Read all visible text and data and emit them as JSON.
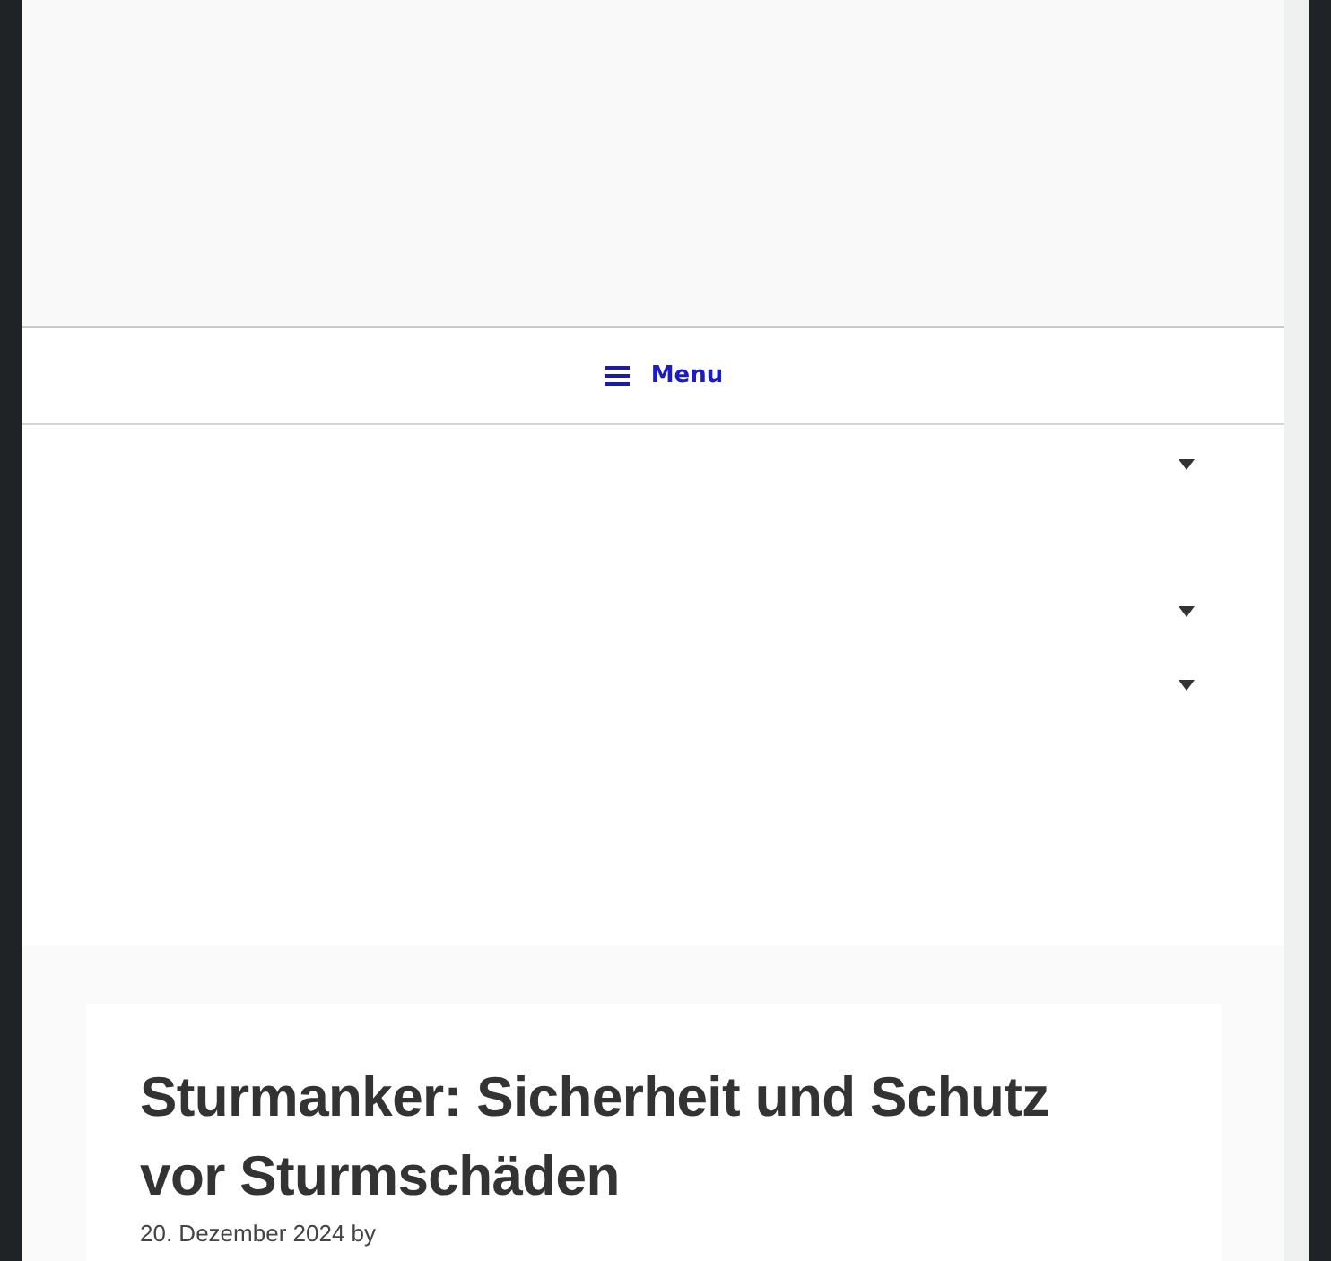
{
  "nav": {
    "menu_label": "Menu"
  },
  "post": {
    "title": "Sturmanker: Sicherheit und Schutz vor Sturmschäden",
    "meta": "20. Dezember 2024 by"
  }
}
